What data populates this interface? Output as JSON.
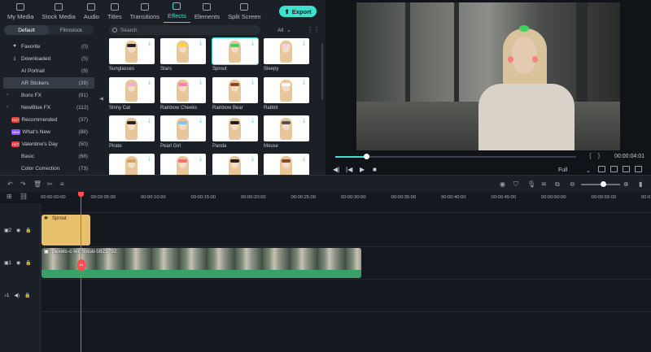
{
  "top_tabs": [
    {
      "label": "My Media",
      "icon": "folder-icon"
    },
    {
      "label": "Stock Media",
      "icon": "cloud-icon"
    },
    {
      "label": "Audio",
      "icon": "music-icon"
    },
    {
      "label": "Titles",
      "icon": "text-icon"
    },
    {
      "label": "Transitions",
      "icon": "transition-icon"
    },
    {
      "label": "Effects",
      "icon": "sparkle-icon"
    },
    {
      "label": "Elements",
      "icon": "elements-icon"
    },
    {
      "label": "Split Screen",
      "icon": "split-screen-icon"
    }
  ],
  "export_label": "Export",
  "segment": {
    "default": "Default",
    "filmstock": "Filmstock"
  },
  "categories": [
    {
      "label": "Favorite",
      "count": "(0)",
      "icon": "heart-icon"
    },
    {
      "label": "Downloaded",
      "count": "(5)",
      "icon": "download-icon"
    },
    {
      "label": "AI Portrait",
      "count": "(9)"
    },
    {
      "label": "AR Stickers",
      "count": "(39)"
    },
    {
      "label": "Boris FX",
      "count": "(91)"
    },
    {
      "label": "NewBlue FX",
      "count": "(112)"
    },
    {
      "label": "Recommended",
      "count": "(37)",
      "badge": "HOT"
    },
    {
      "label": "What's New",
      "count": "(88)",
      "badge": "NEW"
    },
    {
      "label": "Valentine's Day",
      "count": "(50)",
      "badge": "HOT"
    },
    {
      "label": "Basic",
      "count": "(68)"
    },
    {
      "label": "Color Correction",
      "count": "(73)"
    }
  ],
  "search_placeholder": "Search",
  "filter_value": "All",
  "effects": [
    "Sunglasses",
    "Stars",
    "Sprout",
    "Sleepy",
    "Shiny Cat",
    "Rainbow Cheeks",
    "Rainbow Bear",
    "Rabbit",
    "Pirate",
    "Pearl Girl",
    "Panda",
    "Mouse",
    "",
    "",
    "",
    ""
  ],
  "preview": {
    "timecode": "00:00:04:01",
    "zoom": "Full",
    "progress": 0.13
  },
  "ruler": [
    "00:00:00:00",
    "00:00:05:00",
    "00:00:10:00",
    "00:00:15:00",
    "00:00:20:00",
    "00:00:25:00",
    "00:00:30:00",
    "00:00:35:00",
    "00:00:40:00",
    "00:00:45:00",
    "00:00:50:00",
    "00:00:55:00",
    "00:01:00:00"
  ],
  "tracks": {
    "t2": "2",
    "t1": "1",
    "audio": "1"
  },
  "clips": {
    "sprout": "Sprout",
    "video": "pexels-c-technical-5823792"
  },
  "colors": {
    "accent": "#3ee0cf",
    "playhead": "#ff4c4c",
    "sticker_clip": "#e8c06c",
    "video_clip": "#3aa06a"
  }
}
